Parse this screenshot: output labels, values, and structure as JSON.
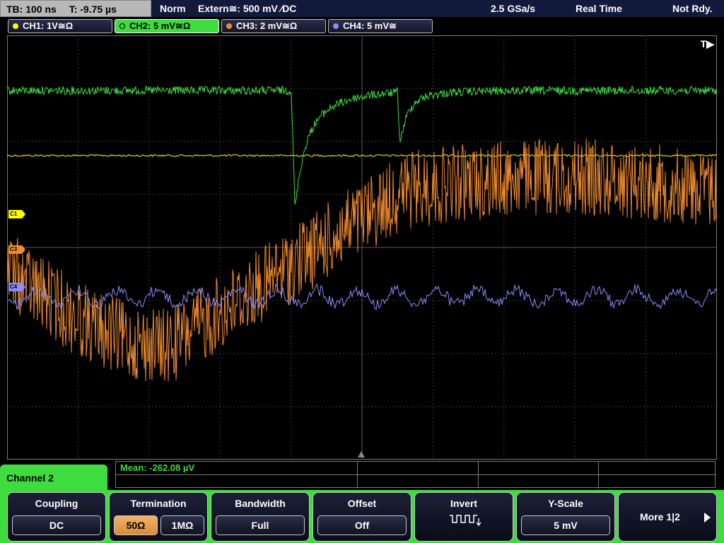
{
  "topbar": {
    "timebase": "TB: 100 ns",
    "trigger_pos": "T: -9.75 µs",
    "mode": "Norm",
    "source": "Extern≅: 500 mV ⁄DC",
    "sample_rate": "2.5 GSa/s",
    "acq_mode": "Real Time",
    "status": "Not Rdy."
  },
  "channels": [
    {
      "label": "CH1: 1V≅Ω",
      "color": "#ffff00",
      "active": false
    },
    {
      "label": "CH2: 5 mV≅Ω",
      "color": "#3edc3e",
      "active": true
    },
    {
      "label": "CH3: 2 mV≅Ω",
      "color": "#f08c30",
      "active": false
    },
    {
      "label": "CH4: 5 mV≅",
      "color": "#8c8cff",
      "active": false
    }
  ],
  "trigger_marker": "T▶",
  "channel_markers": {
    "c1": "C1",
    "c3": "C3",
    "c4": "C4"
  },
  "measurement": {
    "mean": "Mean: -262.08 µV"
  },
  "menu": {
    "title": "Channel 2",
    "coupling": {
      "label": "Coupling",
      "value": "DC"
    },
    "termination": {
      "label": "Termination",
      "opt1": "50Ω",
      "opt2": "1MΩ"
    },
    "bandwidth": {
      "label": "Bandwidth",
      "value": "Full"
    },
    "offset": {
      "label": "Offset",
      "value": "Off"
    },
    "invert": {
      "label": "Invert"
    },
    "yscale": {
      "label": "Y-Scale",
      "value": "5 mV"
    },
    "more": {
      "label": "More 1|2"
    }
  },
  "colors": {
    "ch1": "#ffff00",
    "ch2": "#3edc3e",
    "ch3": "#f08c30",
    "ch4": "#8c8cff",
    "menu": "#3edc3e"
  }
}
